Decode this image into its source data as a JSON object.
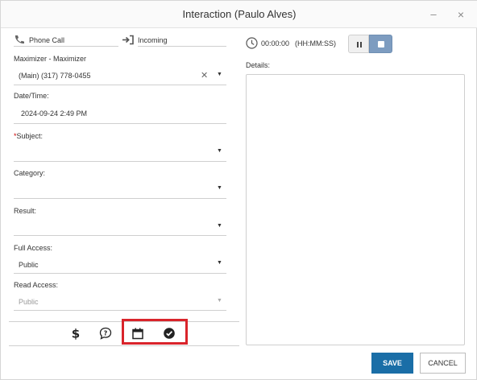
{
  "window": {
    "title": "Interaction (Paulo Alves)",
    "minimize_label": "–",
    "close_label": "×"
  },
  "form": {
    "call_type": "Phone Call",
    "direction": "Incoming",
    "contact_label": "Maximizer - Maximizer",
    "contact_value": "(Main) (317) 778-0455",
    "datetime_label": "Date/Time:",
    "datetime_value": "2024-09-24 2:49 PM",
    "subject_required": "*",
    "subject_label": "Subject:",
    "subject_value": "",
    "category_label": "Category:",
    "category_value": "",
    "result_label": "Result:",
    "result_value": "",
    "full_access_label": "Full Access:",
    "full_access_value": "Public",
    "read_access_label": "Read Access:",
    "read_access_value": "Public"
  },
  "toolbar": {
    "icons": [
      "dollar-icon",
      "question-bubble-icon",
      "calendar-icon",
      "check-circle-icon"
    ]
  },
  "timer": {
    "value": "00:00:00",
    "format": "(HH:MM:SS)"
  },
  "details": {
    "label": "Details:",
    "value": ""
  },
  "actions": {
    "save_label": "SAVE",
    "cancel_label": "CANCEL"
  },
  "colors": {
    "save_button": "#1a6ea7",
    "stop_button": "#7d9cc0",
    "highlight": "#d9242b",
    "required": "#cc0000"
  }
}
